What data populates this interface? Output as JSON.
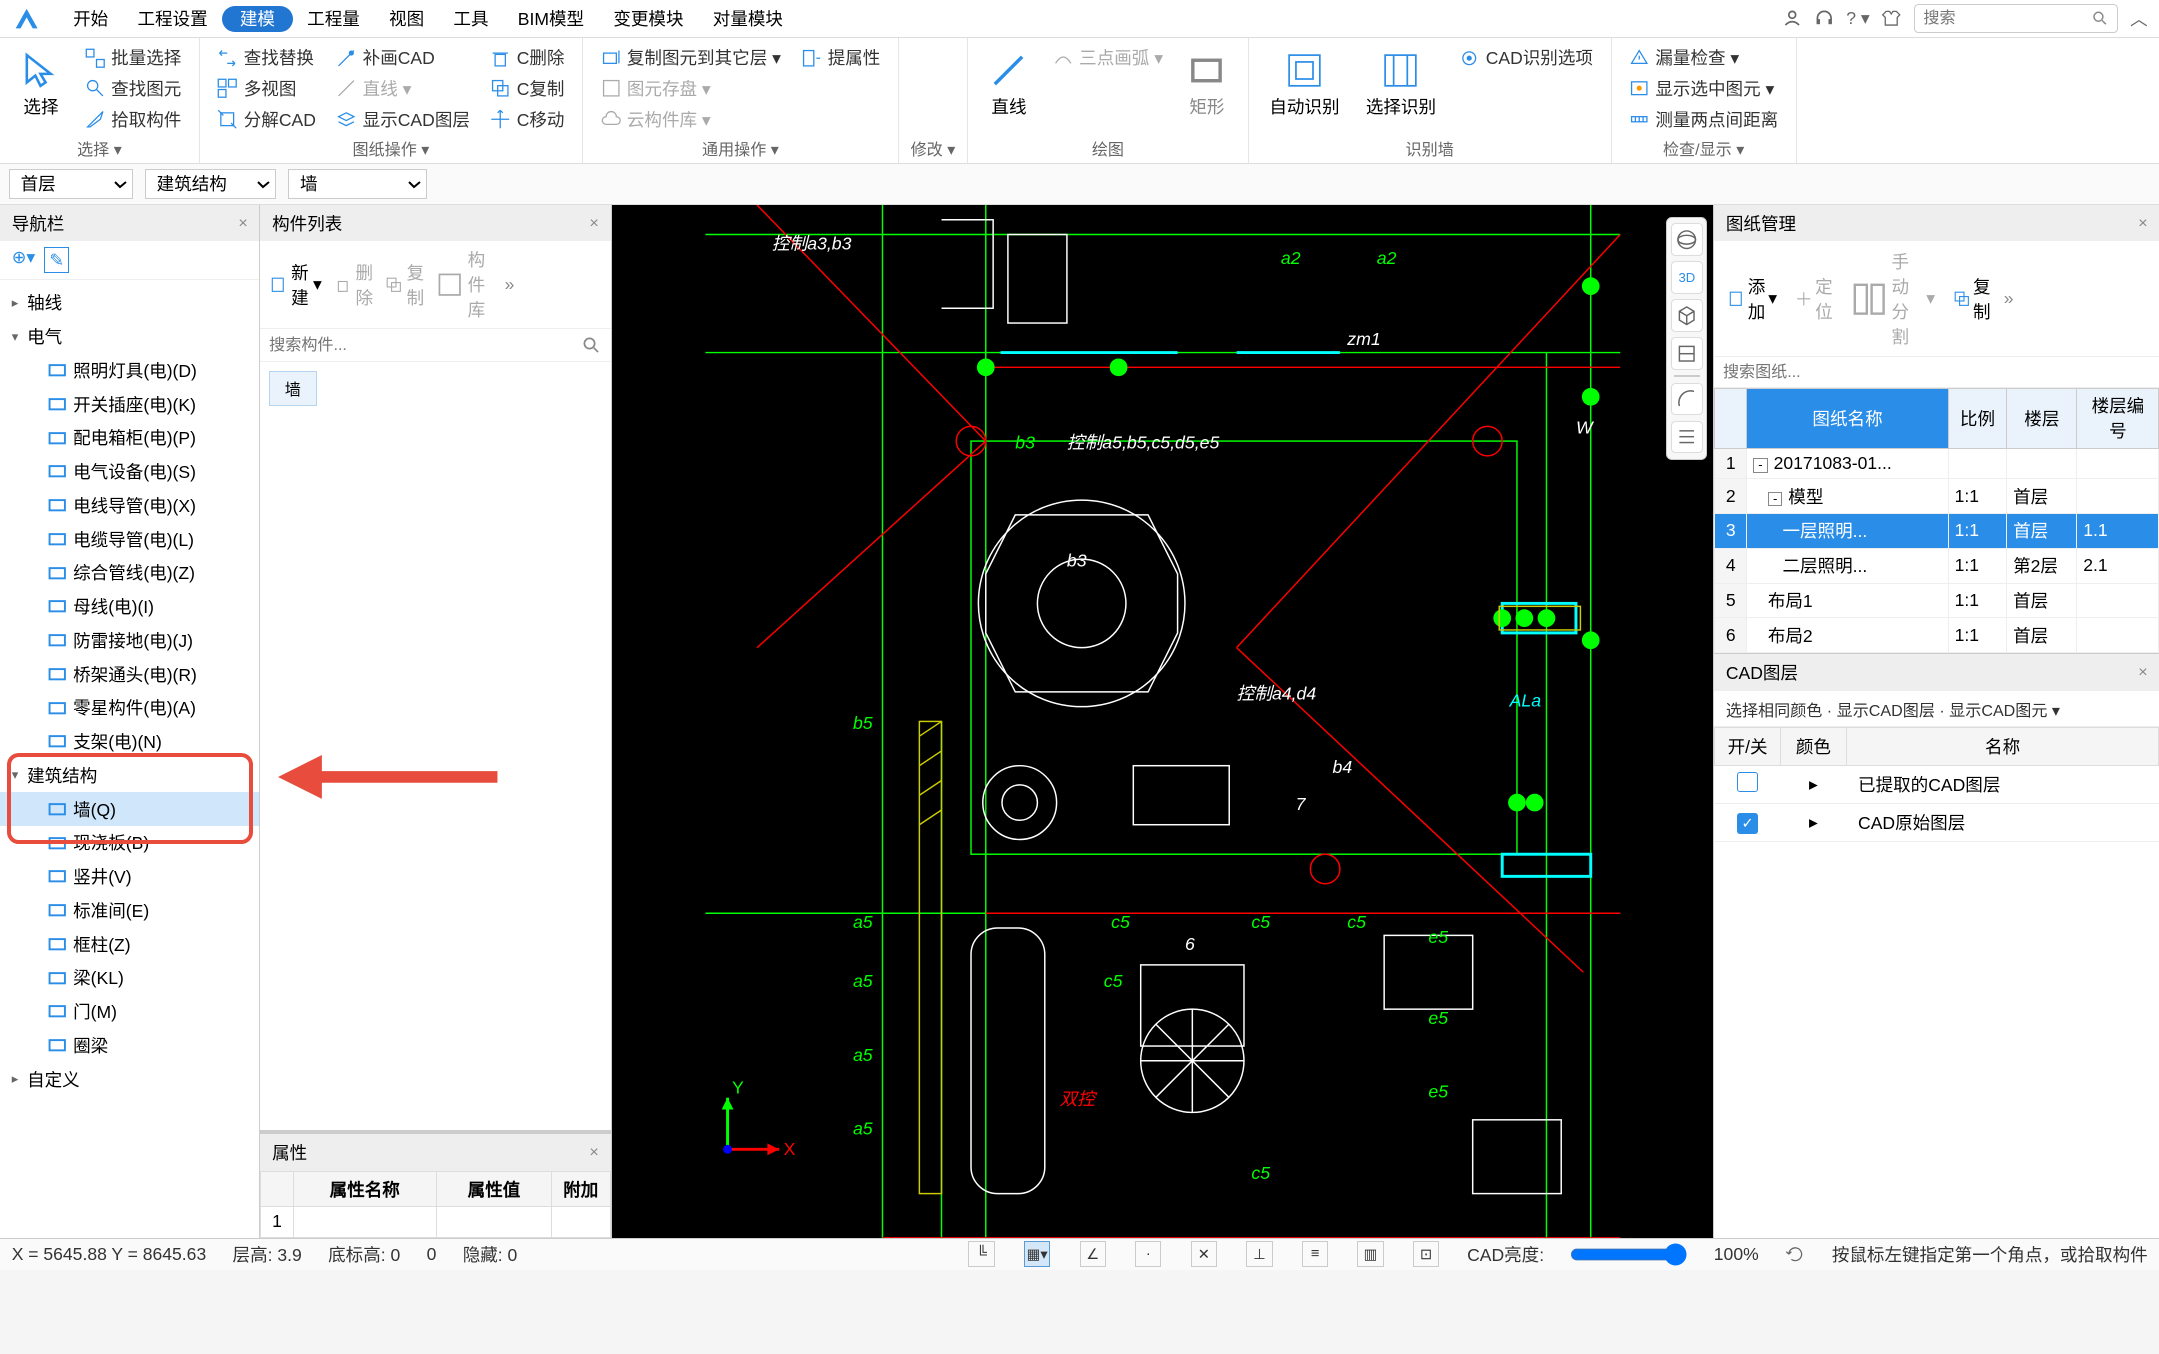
{
  "search_placeholder": "搜索",
  "menu": {
    "items": [
      "开始",
      "工程设置",
      "建模",
      "工程量",
      "视图",
      "工具",
      "BIM模型",
      "变更模块",
      "对量模块"
    ],
    "active_index": 2
  },
  "ribbon": {
    "groups": [
      {
        "label": "选择 ▾",
        "big": [
          {
            "label": "选择"
          }
        ],
        "cols": [
          [
            "批量选择",
            "查找图元",
            "拾取构件"
          ]
        ]
      },
      {
        "label": "图纸操作 ▾",
        "cols": [
          [
            "查找替换",
            "多视图",
            "分解CAD"
          ],
          [
            "补画CAD",
            "直线 ▾",
            "显示CAD图层"
          ],
          [
            "C删除",
            "C复制",
            "C移动"
          ]
        ]
      },
      {
        "label": "通用操作 ▾",
        "cols": [
          [
            "复制图元到其它层 ▾",
            "图元存盘 ▾",
            "云构件库 ▾"
          ],
          [
            "提属性",
            "",
            ""
          ]
        ]
      },
      {
        "label": "修改 ▾",
        "icons_grid": true
      },
      {
        "label": "绘图",
        "big": [
          {
            "label": "直线"
          },
          {
            "label": "矩形"
          }
        ],
        "cols": [
          [
            "三点画弧 ▾",
            "",
            ""
          ]
        ]
      },
      {
        "label": "识别墙",
        "big": [
          {
            "label": "自动识别"
          },
          {
            "label": "选择识别"
          }
        ],
        "cols": [
          [
            "CAD识别选项",
            "",
            ""
          ]
        ]
      },
      {
        "label": "检查/显示 ▾",
        "cols": [
          [
            "漏量检查 ▾",
            "显示选中图元 ▾",
            "测量两点间距离"
          ]
        ]
      }
    ]
  },
  "dropdowns": {
    "floor": "首层",
    "category": "建筑结构",
    "component": "墙"
  },
  "nav": {
    "title": "导航栏",
    "groups": [
      {
        "label": "轴线",
        "open": false,
        "items": []
      },
      {
        "label": "电气",
        "open": true,
        "items": [
          {
            "label": "照明灯具(电)(D)",
            "color": "#2a8de8"
          },
          {
            "label": "开关插座(电)(K)",
            "color": "#2a8de8"
          },
          {
            "label": "配电箱柜(电)(P)",
            "color": "#2a8de8"
          },
          {
            "label": "电气设备(电)(S)",
            "color": "#2a8de8"
          },
          {
            "label": "电线导管(电)(X)",
            "color": "#2a8de8"
          },
          {
            "label": "电缆导管(电)(L)",
            "color": "#2a8de8"
          },
          {
            "label": "综合管线(电)(Z)",
            "color": "#2a8de8"
          },
          {
            "label": "母线(电)(I)",
            "color": "#2a8de8"
          },
          {
            "label": "防雷接地(电)(J)",
            "color": "#2a8de8"
          },
          {
            "label": "桥架通头(电)(R)",
            "color": "#2a8de8"
          },
          {
            "label": "零星构件(电)(A)",
            "color": "#2a8de8"
          },
          {
            "label": "支架(电)(N)",
            "color": "#2a8de8"
          }
        ]
      },
      {
        "label": "建筑结构",
        "open": true,
        "items": [
          {
            "label": "墙(Q)",
            "color": "#2a8de8",
            "selected": true
          },
          {
            "label": "现浇板(B)",
            "color": "#2a8de8"
          },
          {
            "label": "竖井(V)",
            "color": "#2a8de8"
          },
          {
            "label": "标准间(E)",
            "color": "#2a8de8"
          },
          {
            "label": "框柱(Z)",
            "color": "#2a8de8"
          },
          {
            "label": "梁(KL)",
            "color": "#2a8de8"
          },
          {
            "label": "门(M)",
            "color": "#2a8de8"
          },
          {
            "label": "圈梁",
            "color": "#2a8de8"
          }
        ]
      },
      {
        "label": "自定义",
        "open": false,
        "items": []
      }
    ]
  },
  "comp": {
    "title": "构件列表",
    "toolbar": {
      "new": "新建",
      "delete": "删除",
      "copy": "复制",
      "lib": "构件库"
    },
    "search_placeholder": "搜索构件...",
    "items": [
      "墙"
    ]
  },
  "props": {
    "title": "属性",
    "headers": [
      "",
      "属性名称",
      "属性值",
      "附加"
    ],
    "rows": [
      [
        "1",
        "",
        "",
        ""
      ]
    ]
  },
  "canvas": {
    "labels": [
      "控制a3,b3",
      "a2",
      "a2",
      "zm1",
      "控制a5,b5,c5,d5,e5",
      "b3",
      "b3",
      "b5",
      "控制a4,d4",
      "b4",
      "7",
      "ALa",
      "a5",
      "c5",
      "c5",
      "c5",
      "a5",
      "a5",
      "a5",
      "6",
      "e5",
      "e5",
      "e5",
      "c5",
      "c5",
      "双控",
      "W"
    ]
  },
  "drawings": {
    "title": "图纸管理",
    "toolbar": {
      "add": "添加",
      "locate": "定位",
      "split": "手动分割",
      "copy": "复制"
    },
    "search_placeholder": "搜索图纸...",
    "headers": [
      "图纸名称",
      "比例",
      "楼层",
      "楼层编号"
    ],
    "rows": [
      {
        "num": "1",
        "name": "20171083-01...",
        "indent": 0,
        "toggle": "-",
        "ratio": "",
        "floor": "",
        "code": ""
      },
      {
        "num": "2",
        "name": "模型",
        "indent": 1,
        "toggle": "-",
        "ratio": "1:1",
        "floor": "首层",
        "code": ""
      },
      {
        "num": "3",
        "name": "一层照明...",
        "indent": 2,
        "ratio": "1:1",
        "floor": "首层",
        "code": "1.1",
        "selected": true
      },
      {
        "num": "4",
        "name": "二层照明...",
        "indent": 2,
        "ratio": "1:1",
        "floor": "第2层",
        "code": "2.1"
      },
      {
        "num": "5",
        "name": "布局1",
        "indent": 1,
        "ratio": "1:1",
        "floor": "首层",
        "code": ""
      },
      {
        "num": "6",
        "name": "布局2",
        "indent": 1,
        "ratio": "1:1",
        "floor": "首层",
        "code": ""
      }
    ]
  },
  "cad": {
    "title": "CAD图层",
    "toolbar_text": "选择相同颜色 · 显示CAD图层 · 显示CAD图元 ▾",
    "headers": [
      "开/关",
      "颜色",
      "名称"
    ],
    "rows": [
      {
        "on": false,
        "name": "已提取的CAD图层"
      },
      {
        "on": true,
        "name": "CAD原始图层"
      }
    ]
  },
  "status": {
    "coords": "X = 5645.88 Y = 8645.63",
    "floor_height": "层高: 3.9",
    "bottom": "底标高: 0",
    "zero": "0",
    "hidden": "隐藏: 0",
    "opacity_label": "CAD亮度:",
    "opacity_value": "100%",
    "hint": "按鼠标左键指定第一个角点，或拾取构件"
  }
}
